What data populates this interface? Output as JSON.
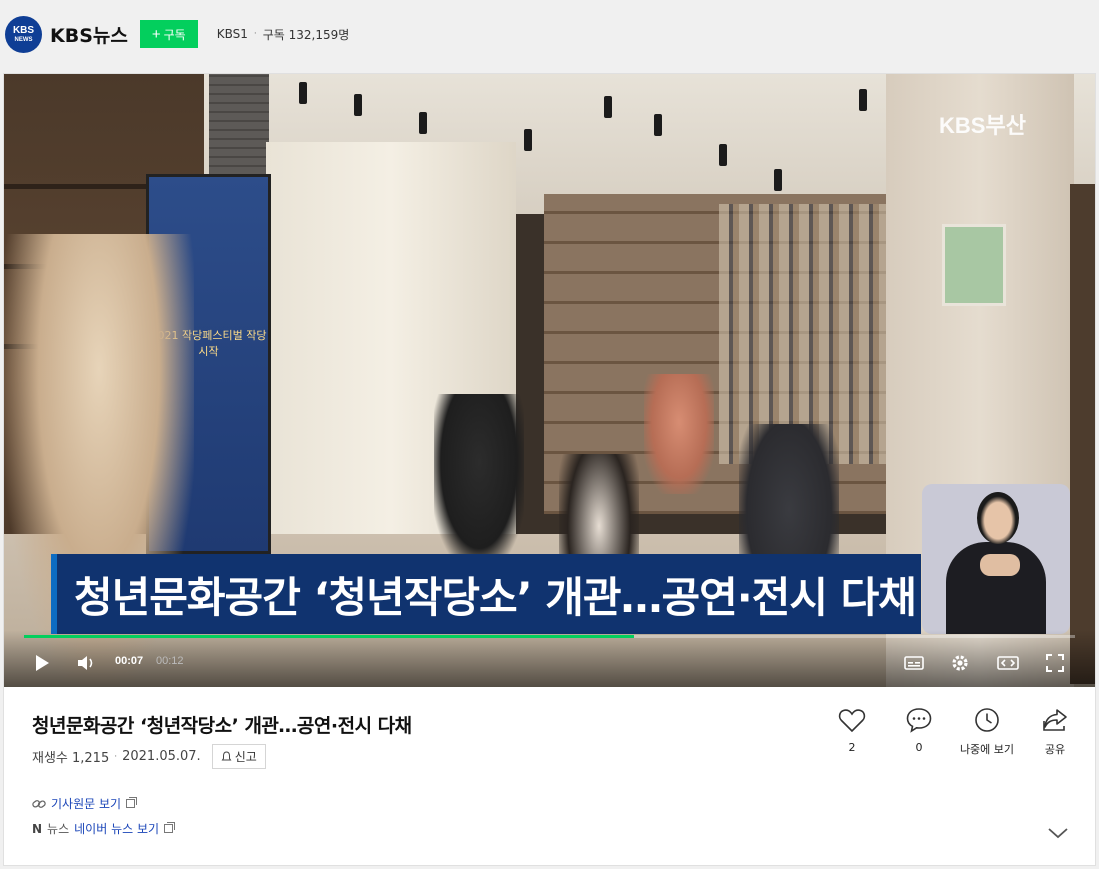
{
  "channel": {
    "logo_line1": "KBS",
    "logo_line2": "NEWS",
    "name": "KBS뉴스",
    "subscribe_label": "구독",
    "broadcast": "KBS1",
    "separator": "·",
    "subscribers": "구독 132,159명"
  },
  "player": {
    "broadcaster_mark": "KBS부산",
    "caption": "청년문화공간 ‘청년작당소’ 개관…공연·전시 다채",
    "banner_text": "2021 작당페스티벌 작당시작",
    "current_time": "00:07",
    "total_time": "00:12",
    "progress": 0.58,
    "controls": [
      "play-icon",
      "volume-icon",
      "subtitle-icon",
      "settings-icon",
      "theater-mode-icon",
      "fullscreen-icon"
    ]
  },
  "video": {
    "title": "청년문화공간 ‘청년작당소’ 개관…공연·전시 다채",
    "views": "재생수 1,215",
    "separator": "·",
    "date": "2021.05.07.",
    "report_label": "신고"
  },
  "actions": {
    "like_count": "2",
    "comment_count": "0",
    "later_label": "나중에 보기",
    "share_label": "공유"
  },
  "links": {
    "original_article": "기사원문 보기",
    "news_source": "뉴스",
    "naver_news": "네이버 뉴스 보기"
  },
  "colors": {
    "accent_green": "#03cf5d",
    "kbs_blue": "#0f3e95",
    "caption_navy": "#10336f",
    "link_blue": "#1a45b8"
  }
}
